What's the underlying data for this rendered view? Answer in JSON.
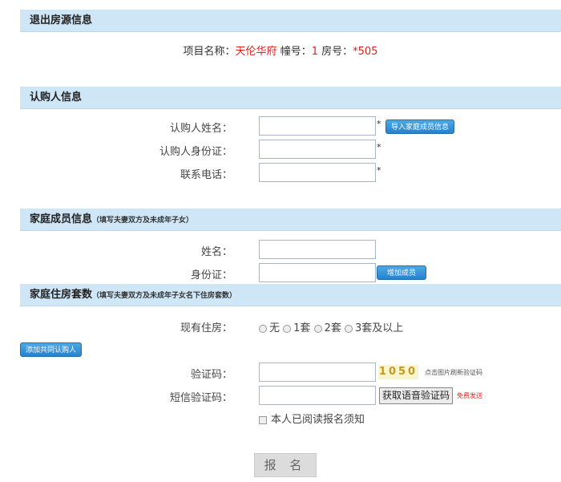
{
  "sections": {
    "exit": {
      "title": "退出房源信息"
    },
    "buyer": {
      "title": "认购人信息"
    },
    "family": {
      "title": "家庭成员信息",
      "note": "（填写夫妻双方及未成年子女）"
    },
    "housing": {
      "title": "家庭住房套数",
      "note": "（填写夫妻双方及未成年子女名下住房套数）"
    }
  },
  "project": {
    "name_label": "项目名称：",
    "name_value": "天伦华府",
    "building_label": " 幢号：",
    "building_value": "1",
    "room_label": " 房号：",
    "room_value": "*505"
  },
  "buyer_form": {
    "name_label": "认购人姓名：",
    "id_label": "认购人身份证：",
    "phone_label": "联系电话：",
    "required_mark": "*",
    "import_button": "导入家庭成员信息"
  },
  "family_form": {
    "name_label": "姓名：",
    "id_label": "身份证：",
    "add_member_button": "增加成员"
  },
  "housing_form": {
    "label": "现有住房：",
    "options": [
      "无",
      "1套",
      "2套",
      "3套及以上"
    ]
  },
  "add_cobuyer_button": "添加共同认购人",
  "verify": {
    "captcha_label": "验证码：",
    "captcha_value": "1050",
    "captcha_hint": "点击图片刷新验证码",
    "sms_label": "短信验证码：",
    "voice_button": "获取语音验证码",
    "free_send": "免费发送",
    "agree_text": "本人已阅读报名须知"
  },
  "submit_button": "报 名"
}
